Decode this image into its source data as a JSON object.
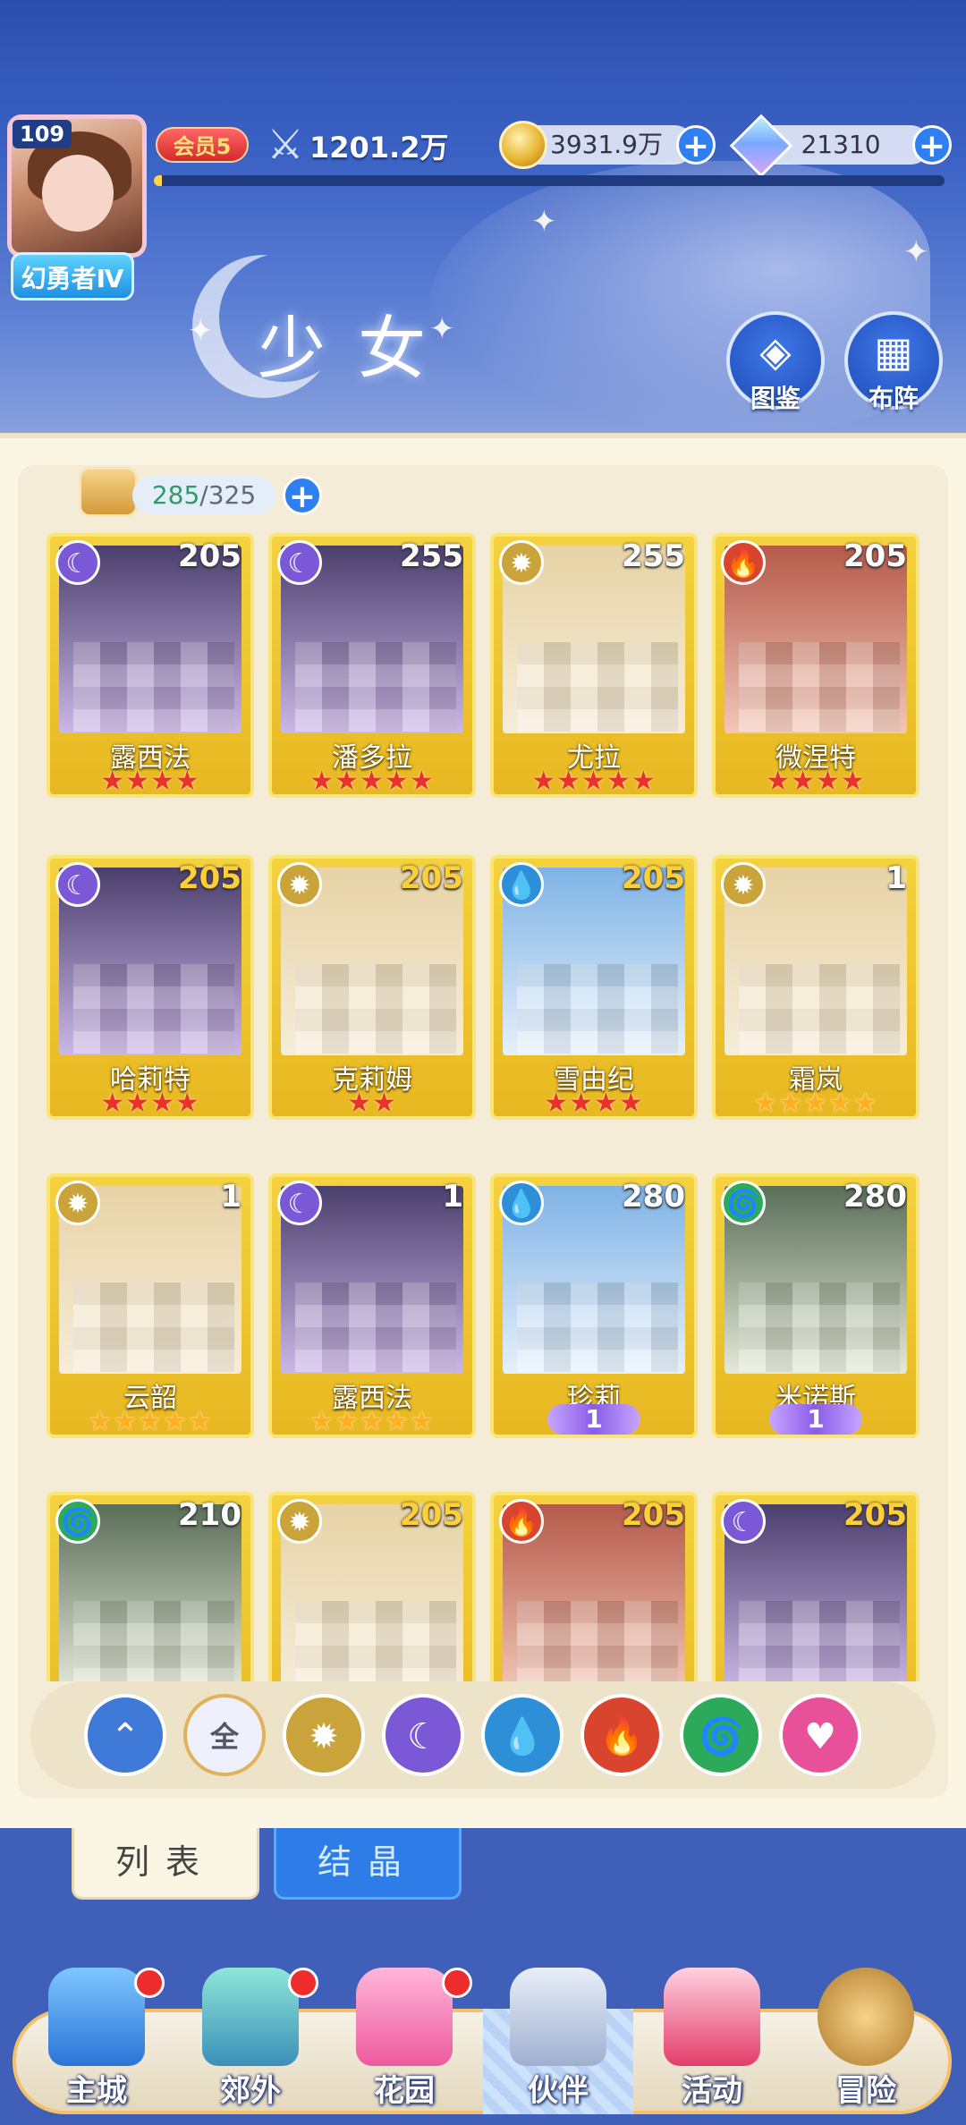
{
  "player": {
    "level": "109",
    "title": "幻勇者Ⅳ",
    "vip": "会员5",
    "power": "1201.2万",
    "exp_progress": 0.01
  },
  "resources": {
    "gold": "3931.9万",
    "gems": "21310"
  },
  "page": {
    "title": "少女",
    "codex_label": "图鉴",
    "formation_label": "布阵"
  },
  "capacity": {
    "current": "285",
    "max": "325"
  },
  "cards": [
    {
      "name": "露西法",
      "level": "205",
      "element": "star",
      "stars": 4,
      "star_color": "red"
    },
    {
      "name": "潘多拉",
      "level": "255",
      "element": "star",
      "stars": 5,
      "star_color": "red"
    },
    {
      "name": "尤拉",
      "level": "255",
      "element": "sun",
      "stars": 5,
      "star_color": "red"
    },
    {
      "name": "微涅特",
      "level": "205",
      "element": "fire",
      "stars": 4,
      "star_color": "red"
    },
    {
      "name": "哈莉特",
      "level": "205",
      "element": "star",
      "stars": 4,
      "star_color": "red"
    },
    {
      "name": "克莉姆",
      "level": "205",
      "element": "sun",
      "stars": 2,
      "star_color": "red"
    },
    {
      "name": "雪由纪",
      "level": "205",
      "element": "water",
      "stars": 4,
      "star_color": "red"
    },
    {
      "name": "霜岚",
      "level": "1",
      "element": "sun",
      "stars": 5,
      "star_color": "gold"
    },
    {
      "name": "云韶",
      "level": "1",
      "element": "sun",
      "stars": 5,
      "star_color": "gold"
    },
    {
      "name": "露西法",
      "level": "1",
      "element": "star",
      "stars": 5,
      "star_color": "gold"
    },
    {
      "name": "珍莉",
      "level": "280",
      "element": "water",
      "awaken": "1"
    },
    {
      "name": "米诺斯",
      "level": "280",
      "element": "wind",
      "awaken": "1"
    },
    {
      "name": "",
      "level": "210",
      "element": "wind"
    },
    {
      "name": "",
      "level": "205",
      "element": "sun"
    },
    {
      "name": "",
      "level": "205",
      "element": "fire"
    },
    {
      "name": "",
      "level": "205",
      "element": "star"
    }
  ],
  "filters": [
    {
      "id": "sort",
      "icon": "sort-icon"
    },
    {
      "id": "all",
      "label": "全"
    },
    {
      "id": "sun",
      "icon": "sun-element-icon"
    },
    {
      "id": "star",
      "icon": "moon-element-icon"
    },
    {
      "id": "water",
      "icon": "water-element-icon"
    },
    {
      "id": "fire",
      "icon": "fire-element-icon"
    },
    {
      "id": "wind",
      "icon": "wind-element-icon"
    },
    {
      "id": "pink",
      "icon": "heart-element-icon"
    }
  ],
  "tabs": {
    "list": "列表",
    "crystal": "结晶"
  },
  "nav": [
    {
      "label": "主城",
      "badge": true
    },
    {
      "label": "郊外",
      "badge": true
    },
    {
      "label": "花园",
      "badge": true
    },
    {
      "label": "伙伴",
      "badge": false,
      "active": true
    },
    {
      "label": "活动",
      "badge": false
    },
    {
      "label": "冒险",
      "badge": false
    }
  ],
  "colors": {
    "element_star": "#7a58d6",
    "element_sun": "#caa43a",
    "element_water": "#2d8fd8",
    "element_fire": "#d9442f",
    "element_wind": "#2caa5a"
  }
}
